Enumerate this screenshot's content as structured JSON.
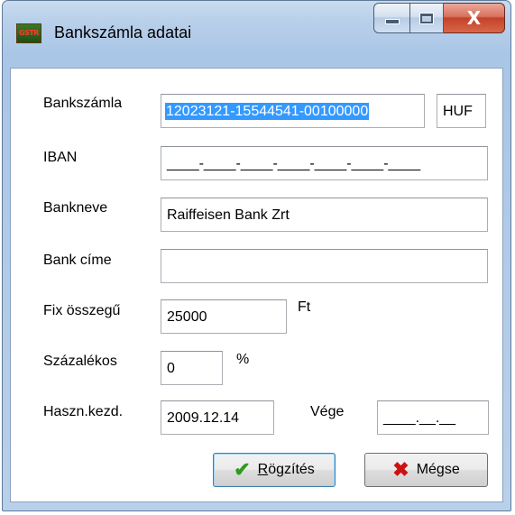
{
  "window": {
    "title": "Bankszámla adatai",
    "icon": "app-icon",
    "icon_text": "GSTR",
    "controls": {
      "minimize": "minimize-icon",
      "maximize": "maximize-icon",
      "close": "X"
    }
  },
  "form": {
    "bankszamla": {
      "label": "Bankszámla",
      "value": "12023121-15544541-00100000",
      "currency": "HUF"
    },
    "iban": {
      "label": "IBAN",
      "value": "____-____-____-____-____-____-____"
    },
    "bankneve": {
      "label": "Bankneve",
      "value": "Raiffeisen Bank Zrt"
    },
    "bank_cime": {
      "label": "Bank címe",
      "value": ""
    },
    "fix_osszegu": {
      "label": "Fix összegű",
      "value": "25000",
      "unit": "Ft"
    },
    "szazalekos": {
      "label": "Százalékos",
      "value": "0",
      "unit": "%"
    },
    "haszn_kezd": {
      "label": "Haszn.kezd.",
      "value": "2009.12.14"
    },
    "vege": {
      "label": "Vége",
      "value": "____.__.__"
    }
  },
  "buttons": {
    "rogzites": {
      "label_first": "R",
      "label_rest": "ögzítés",
      "icon": "checkmark-icon"
    },
    "megse": {
      "label": "Mégse",
      "icon": "x-icon"
    }
  },
  "colors": {
    "selection": "#3399ff",
    "check": "#2f9a1c",
    "cross": "#cc1111",
    "close_button": "#c44128"
  }
}
